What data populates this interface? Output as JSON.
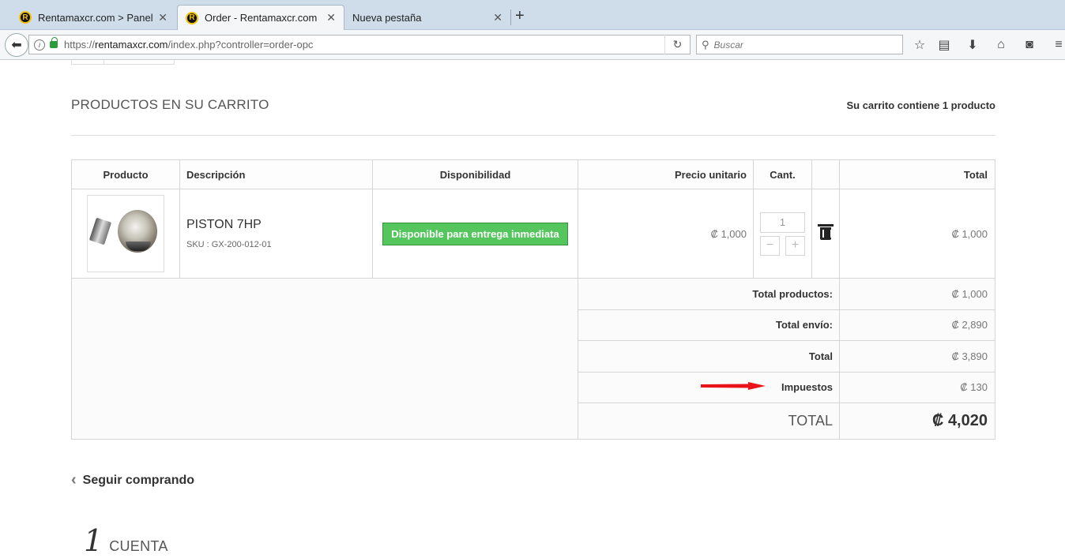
{
  "browser": {
    "tabs": [
      {
        "label": "Rentamaxcr.com > Panel d...",
        "active": false
      },
      {
        "label": "Order - Rentamaxcr.com",
        "active": true
      },
      {
        "label": "Nueva pestaña",
        "active": false
      }
    ],
    "favicon_letter": "R",
    "new_tab": "+",
    "url_prefix": "https://",
    "url_domain": "rentamaxcr.com",
    "url_path": "/index.php?controller=order-opc",
    "search_placeholder": "Buscar"
  },
  "cart": {
    "heading": "PRODUCTOS EN SU CARRITO",
    "summary": "Su carrito contiene 1 producto",
    "columns": {
      "product": "Producto",
      "description": "Descripción",
      "availability": "Disponibilidad",
      "unit_price": "Precio unitario",
      "qty": "Cant.",
      "total": "Total"
    },
    "item": {
      "name": "PISTON 7HP",
      "sku": "SKU : GX-200-012-01",
      "availability": "Disponible para entrega inmediata",
      "unit_price": "₡ 1,000",
      "qty": "1",
      "total": "₡ 1,000"
    },
    "totals": [
      {
        "label": "Total productos:",
        "value": "₡ 1,000"
      },
      {
        "label": "Total envío:",
        "value": "₡ 2,890"
      },
      {
        "label": "Total",
        "value": "₡ 3,890"
      },
      {
        "label": "Impuestos",
        "value": "₡ 130"
      }
    ],
    "grand_total_label": "TOTAL",
    "grand_total_value": "₡ 4,020",
    "annotation_color": "#e8141a"
  },
  "continue_shopping": "Seguir comprando",
  "step": {
    "number": "1",
    "label": "CUENTA"
  }
}
